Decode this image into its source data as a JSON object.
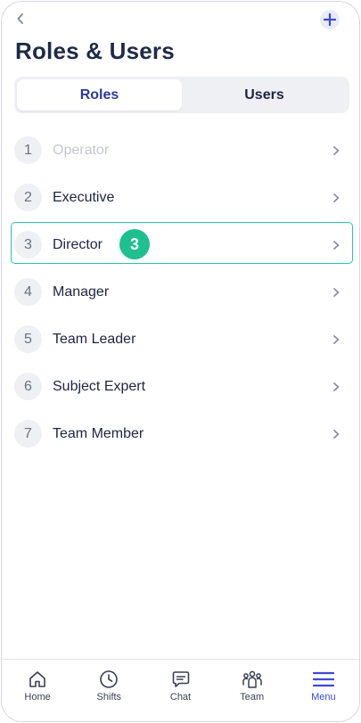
{
  "header": {
    "title": "Roles & Users",
    "back_icon": "chevron-left-icon",
    "add_icon": "plus-icon"
  },
  "tabs": [
    {
      "label": "Roles",
      "active": true
    },
    {
      "label": "Users",
      "active": false
    }
  ],
  "roles": [
    {
      "number": "1",
      "label": "Operator",
      "disabled": true
    },
    {
      "number": "2",
      "label": "Executive",
      "disabled": false
    },
    {
      "number": "3",
      "label": "Director",
      "disabled": false,
      "highlighted": true
    },
    {
      "number": "4",
      "label": "Manager",
      "disabled": false
    },
    {
      "number": "5",
      "label": "Team Leader",
      "disabled": false
    },
    {
      "number": "6",
      "label": "Subject Expert",
      "disabled": false
    },
    {
      "number": "7",
      "label": "Team Member",
      "disabled": false
    }
  ],
  "step_badge": "3",
  "bottom_nav": [
    {
      "label": "Home",
      "icon": "home-icon",
      "active": false
    },
    {
      "label": "Shifts",
      "icon": "clock-icon",
      "active": false
    },
    {
      "label": "Chat",
      "icon": "chat-icon",
      "active": false
    },
    {
      "label": "Team",
      "icon": "team-icon",
      "active": false
    },
    {
      "label": "Menu",
      "icon": "menu-icon",
      "active": true
    }
  ],
  "colors": {
    "accent": "#3c4ad6",
    "highlight_border": "#27c8a0",
    "badge": "#1fbf8f",
    "title": "#1e2a4a"
  }
}
